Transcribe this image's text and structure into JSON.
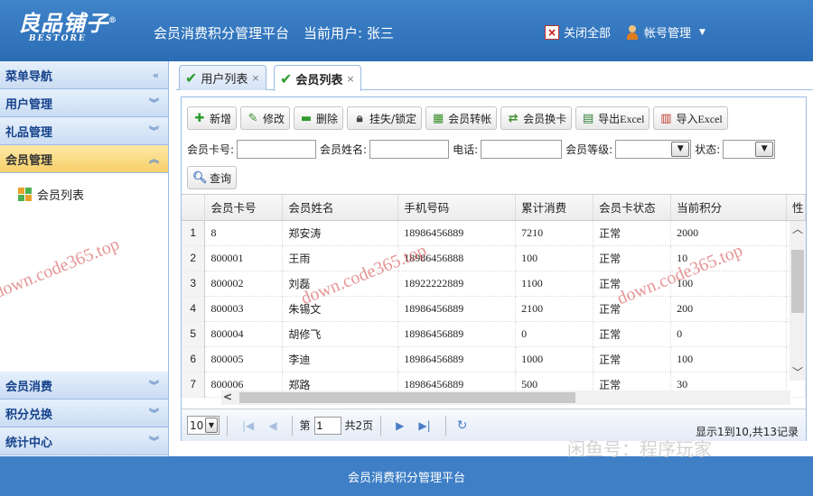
{
  "header": {
    "logo_main": "良品铺子",
    "logo_mark": "®",
    "logo_sub": "BESTORE",
    "app_title": "会员消费积分管理平台",
    "current_user": "当前用户: 张三",
    "close_all": "关闭全部",
    "account": "帐号管理"
  },
  "sidebar": {
    "nav_title": "菜单导航",
    "sections": [
      "用户管理",
      "礼品管理",
      "会员管理"
    ],
    "items": [
      "会员列表"
    ],
    "bottom_sections": [
      "会员消费",
      "积分兑换",
      "统计中心"
    ]
  },
  "tabs": [
    "用户列表",
    "会员列表"
  ],
  "toolbar": [
    "新增",
    "修改",
    "删除",
    "挂失/锁定",
    "会员转帐",
    "会员换卡",
    "导出Excel",
    "导入Excel"
  ],
  "search": {
    "card_label": "会员卡号:",
    "name_label": "会员姓名:",
    "phone_label": "电话:",
    "level_label": "会员等级:",
    "status_label": "状态:",
    "query_label": "查询"
  },
  "grid": {
    "columns": [
      "会员卡号",
      "会员姓名",
      "手机号码",
      "累计消费",
      "会员卡状态",
      "当前积分",
      "性"
    ],
    "rows": [
      [
        "1",
        "8",
        "郑安涛",
        "18986456889",
        "7210",
        "正常",
        "2000"
      ],
      [
        "2",
        "800001",
        "王雨",
        "18986456888",
        "100",
        "正常",
        "10"
      ],
      [
        "3",
        "800002",
        "刘磊",
        "18922222889",
        "1100",
        "正常",
        "100"
      ],
      [
        "4",
        "800003",
        "朱锡文",
        "18986456889",
        "2100",
        "正常",
        "200"
      ],
      [
        "5",
        "800004",
        "胡修飞",
        "18986456889",
        "0",
        "正常",
        "0"
      ],
      [
        "6",
        "800005",
        "李迪",
        "18986456889",
        "1000",
        "正常",
        "100"
      ],
      [
        "7",
        "800006",
        "郑路",
        "18986456889",
        "500",
        "正常",
        "30"
      ]
    ]
  },
  "pager": {
    "page_size": "10",
    "page_prefix": "第",
    "current_page": "1",
    "total_pages": "共2页",
    "info": "显示1到10,共13记录"
  },
  "footer": "会员消费积分管理平台",
  "watermarks": [
    "down.code365.top",
    "闲鱼号：程序玩家"
  ]
}
